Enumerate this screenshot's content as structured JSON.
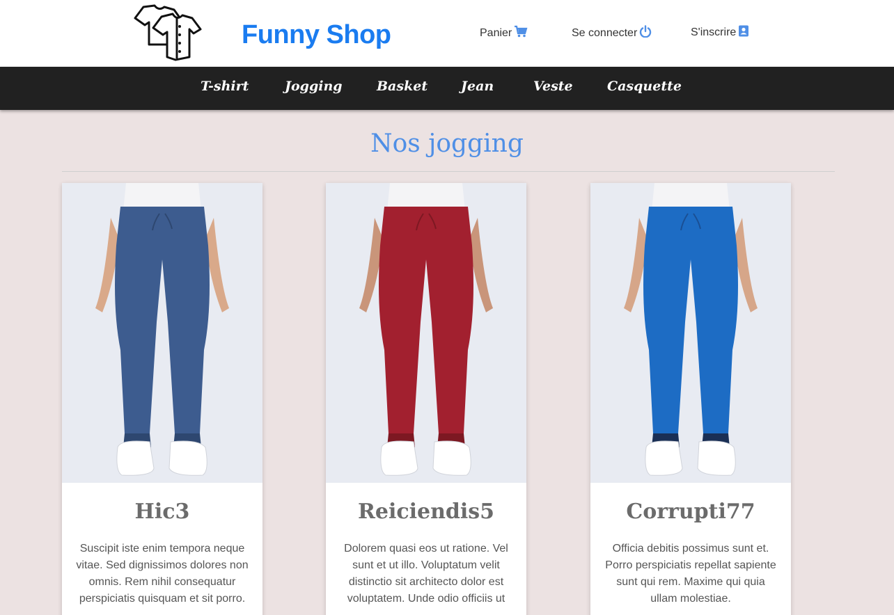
{
  "header": {
    "brand": "Funny Shop",
    "links": {
      "cart": "Panier",
      "login": "Se connecter",
      "signup": "S'inscrire"
    },
    "icons": {
      "logo": "shirts-logo-icon",
      "cart": "cart-icon",
      "login": "power-icon",
      "signup": "contact-card-icon"
    },
    "colors": {
      "brand": "#1a7cf0",
      "icon": "#4f8fe6"
    }
  },
  "nav": {
    "items": [
      "T-shirt",
      "Jogging",
      "Basket",
      "Jean",
      "Veste",
      "Casquette"
    ]
  },
  "section": {
    "title": "Nos jogging"
  },
  "products": [
    {
      "name": "Hic3",
      "description": "Suscipit iste enim tempora neque vitae. Sed dignissimos dolores non omnis. Rem nihil consequatur perspiciatis quisquam et sit porro.",
      "pants_color": "#3d5c8f"
    },
    {
      "name": "Reiciendis5",
      "description": "Dolorem quasi eos ut ratione. Vel sunt et ut illo. Voluptatum velit distinctio sit architecto dolor est voluptatem. Unde odio officiis ut",
      "pants_color": "#a2202f"
    },
    {
      "name": "Corrupti77",
      "description": "Officia debitis possimus sunt et. Porro perspiciatis repellat sapiente sunt qui rem. Maxime qui quia ullam molestiae.",
      "pants_color": "#1d6cc4"
    }
  ]
}
